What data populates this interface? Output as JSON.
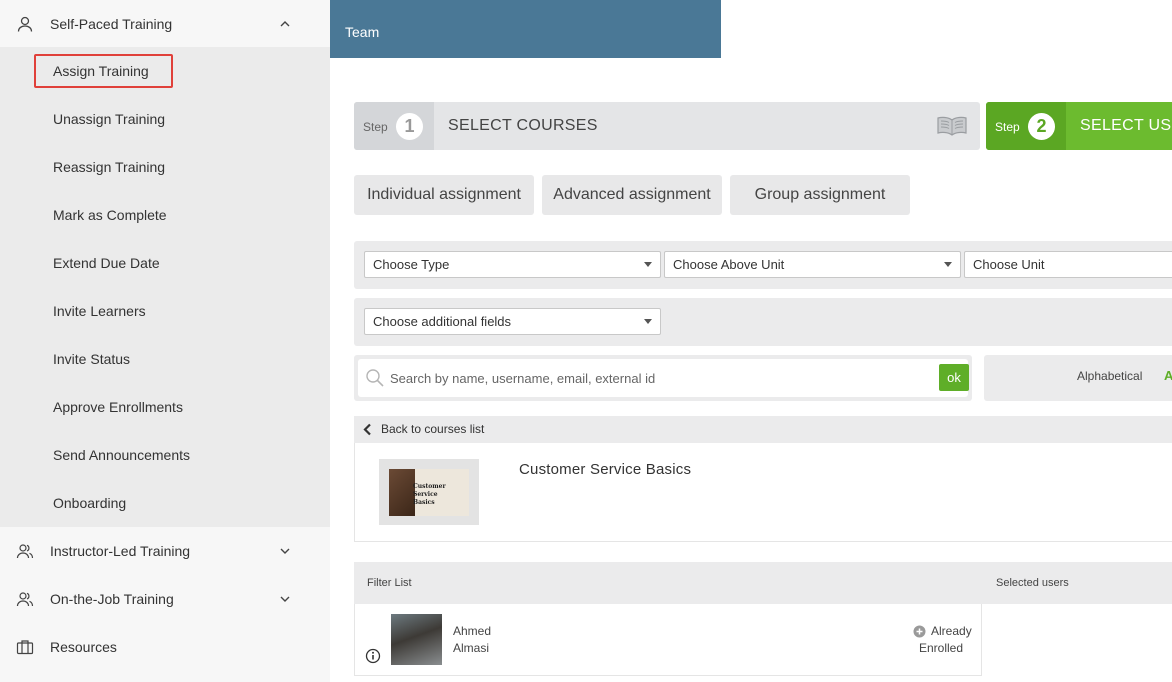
{
  "sidebar": {
    "sections": [
      {
        "label": "Self-Paced Training",
        "icon": "person-icon",
        "expanded": true
      },
      {
        "label": "Instructor-Led Training",
        "icon": "people-icon",
        "expanded": false
      },
      {
        "label": "On-the-Job Training",
        "icon": "people-icon",
        "expanded": false
      },
      {
        "label": "Resources",
        "icon": "briefcase-icon"
      }
    ],
    "submenu": [
      {
        "label": "Assign Training",
        "active": true
      },
      {
        "label": "Unassign Training"
      },
      {
        "label": "Reassign Training"
      },
      {
        "label": "Mark as Complete"
      },
      {
        "label": "Extend Due Date"
      },
      {
        "label": "Invite Learners"
      },
      {
        "label": "Invite Status"
      },
      {
        "label": "Approve Enrollments"
      },
      {
        "label": "Send Announcements"
      },
      {
        "label": "Onboarding"
      }
    ]
  },
  "header": {
    "team": "Team"
  },
  "steps": [
    {
      "word": "Step",
      "number": "1",
      "title": "SELECT COURSES",
      "icon": "open-book-icon"
    },
    {
      "word": "Step",
      "number": "2",
      "title": "SELECT USER"
    }
  ],
  "assignment_tabs": [
    "Individual assignment",
    "Advanced assignment",
    "Group assignment"
  ],
  "filters": {
    "type": "Choose Type",
    "above_unit": "Choose Above Unit",
    "unit": "Choose Unit",
    "additional": "Choose additional fields"
  },
  "search": {
    "placeholder": "Search by name, username, email, external id",
    "ok": "ok"
  },
  "sort": {
    "label": "Alphabetical",
    "accent": "A"
  },
  "back_link": "Back to courses list",
  "course": {
    "title": "Customer Service Basics",
    "thumb_text_1": "Customer Service",
    "thumb_text_2": "Basics"
  },
  "list": {
    "filter_label": "Filter List",
    "selected_label": "Selected users"
  },
  "users": [
    {
      "first": "Ahmed",
      "last": "Almasi",
      "status_1": "Already",
      "status_2": "Enrolled"
    }
  ],
  "colors": {
    "team_bar": "#4a7896",
    "accent_green": "#6cbb2f",
    "highlight_red": "#e0403a"
  }
}
